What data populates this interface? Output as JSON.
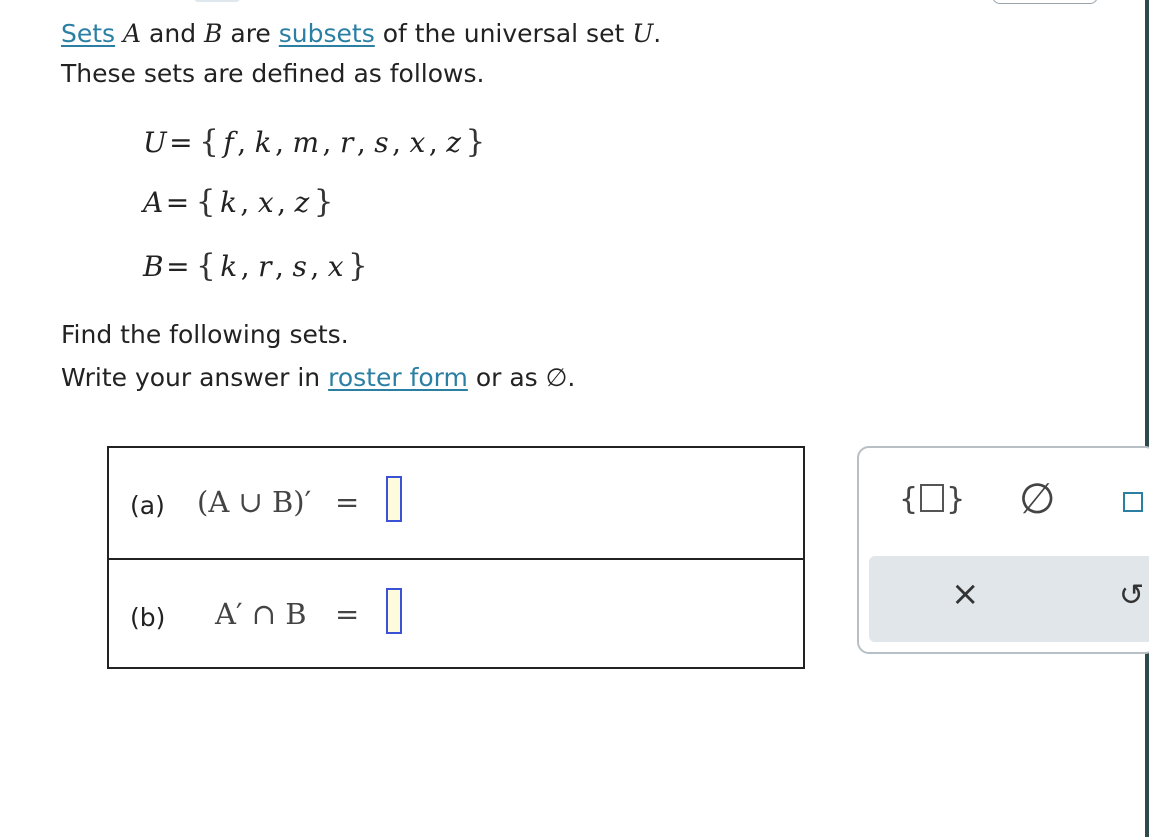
{
  "problem": {
    "intro_line1": {
      "link_sets": "Sets",
      "var_A": "A",
      "and_text": "and",
      "var_B": "B",
      "are_text": "are",
      "link_subsets": "subsets",
      "rest_text": "of the universal set",
      "var_U": "U",
      "period": "."
    },
    "intro_line2": "These sets are defined as follows.",
    "definitions": {
      "U": {
        "name": "U",
        "elements": [
          "f",
          "k",
          "m",
          "r",
          "s",
          "x",
          "z"
        ]
      },
      "A": {
        "name": "A",
        "elements": [
          "k",
          "x",
          "z"
        ]
      },
      "B": {
        "name": "B",
        "elements": [
          "k",
          "r",
          "s",
          "x"
        ]
      }
    },
    "instruction_line1": "Find the following sets.",
    "instruction_line2": {
      "before_link": "Write your answer in",
      "link_text": "roster form",
      "after_link": "or as ∅."
    }
  },
  "answers": {
    "a": {
      "label": "(a)",
      "expression": "(A ∪ B)′",
      "equals": "=",
      "value": ""
    },
    "b": {
      "label": "(b)",
      "expression": "A′ ∩ B",
      "equals": "=",
      "value": ""
    }
  },
  "toolbar": {
    "roster_button": "roster-braces",
    "empty_set_button": "∅",
    "box_button": "box",
    "clear_button": "×",
    "undo_button": "↺"
  },
  "colors": {
    "link": "#2a7fa3",
    "answer_box_border": "#3a52d6",
    "answer_box_fill": "#fdfbdc",
    "tool_lower_bg": "#e1e6ea",
    "right_rail": "#2f4a4b"
  }
}
